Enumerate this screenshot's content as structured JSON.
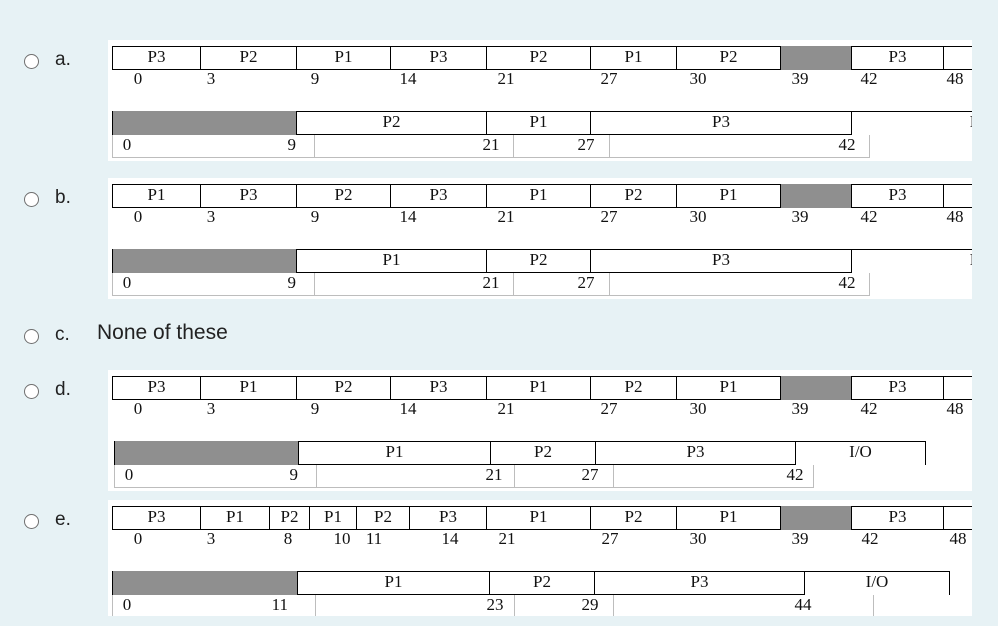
{
  "options": [
    {
      "letter": "a.",
      "cpu": [
        {
          "label": "P3",
          "start": 0,
          "end": 3
        },
        {
          "label": "P2",
          "start": 3,
          "end": 9
        },
        {
          "label": "P1",
          "start": 9,
          "end": 14
        },
        {
          "label": "P3",
          "start": 14,
          "end": 21
        },
        {
          "label": "P2",
          "start": 21,
          "end": 27
        },
        {
          "label": "P1",
          "start": 27,
          "end": 30
        },
        {
          "label": "P2",
          "start": 30,
          "end": 39
        },
        {
          "label": "",
          "start": 39,
          "end": 42,
          "idle": true
        },
        {
          "label": "P3",
          "start": 42,
          "end": 48
        }
      ],
      "cpu_ticks": [
        "0",
        "3",
        "9",
        "14",
        "21",
        "27",
        "30",
        "39",
        "42",
        "48"
      ],
      "io": [
        {
          "label": "",
          "start": 0,
          "end": 9,
          "idle": true
        },
        {
          "label": "P2",
          "start": 9,
          "end": 21
        },
        {
          "label": "P1",
          "start": 21,
          "end": 27
        },
        {
          "label": "P3",
          "start": 27,
          "end": 42
        },
        {
          "label": "I/",
          "start": 42,
          "end": 48,
          "cut": true
        }
      ],
      "io_ticks": [
        "0",
        "9",
        "21",
        "27",
        "42"
      ]
    },
    {
      "letter": "b.",
      "cpu": [
        {
          "label": "P1",
          "start": 0,
          "end": 3
        },
        {
          "label": "P3",
          "start": 3,
          "end": 9
        },
        {
          "label": "P2",
          "start": 9,
          "end": 14
        },
        {
          "label": "P3",
          "start": 14,
          "end": 21
        },
        {
          "label": "P1",
          "start": 21,
          "end": 27
        },
        {
          "label": "P2",
          "start": 27,
          "end": 30
        },
        {
          "label": "P1",
          "start": 30,
          "end": 39
        },
        {
          "label": "",
          "start": 39,
          "end": 42,
          "idle": true
        },
        {
          "label": "P3",
          "start": 42,
          "end": 48
        }
      ],
      "cpu_ticks": [
        "0",
        "3",
        "9",
        "14",
        "21",
        "27",
        "30",
        "39",
        "42",
        "48"
      ],
      "io": [
        {
          "label": "",
          "start": 0,
          "end": 9,
          "idle": true
        },
        {
          "label": "P1",
          "start": 9,
          "end": 21
        },
        {
          "label": "P2",
          "start": 21,
          "end": 27
        },
        {
          "label": "P3",
          "start": 27,
          "end": 42
        },
        {
          "label": "I/",
          "start": 42,
          "end": 48,
          "cut": true
        }
      ],
      "io_ticks": [
        "0",
        "9",
        "21",
        "27",
        "42"
      ]
    },
    {
      "letter": "c.",
      "text": "None of these"
    },
    {
      "letter": "d.",
      "cpu": [
        {
          "label": "P3",
          "start": 0,
          "end": 3
        },
        {
          "label": "P1",
          "start": 3,
          "end": 9
        },
        {
          "label": "P2",
          "start": 9,
          "end": 14
        },
        {
          "label": "P3",
          "start": 14,
          "end": 21
        },
        {
          "label": "P1",
          "start": 21,
          "end": 27
        },
        {
          "label": "P2",
          "start": 27,
          "end": 30
        },
        {
          "label": "P1",
          "start": 30,
          "end": 39
        },
        {
          "label": "",
          "start": 39,
          "end": 42,
          "idle": true
        },
        {
          "label": "P3",
          "start": 42,
          "end": 48
        }
      ],
      "cpu_ticks": [
        "0",
        "3",
        "9",
        "14",
        "21",
        "27",
        "30",
        "39",
        "42",
        "48"
      ],
      "io": [
        {
          "label": "",
          "start": 0,
          "end": 9,
          "idle": true
        },
        {
          "label": "P1",
          "start": 9,
          "end": 21
        },
        {
          "label": "P2",
          "start": 21,
          "end": 27
        },
        {
          "label": "P3",
          "start": 27,
          "end": 42
        },
        {
          "label": "I/O",
          "start": 42,
          "end": 48
        }
      ],
      "io_ticks": [
        "0",
        "9",
        "21",
        "27",
        "42"
      ]
    },
    {
      "letter": "e.",
      "cpu": [
        {
          "label": "P3",
          "start": 0,
          "end": 3
        },
        {
          "label": "P1",
          "start": 3,
          "end": 8
        },
        {
          "label": "P2",
          "start": 8,
          "end": 10
        },
        {
          "label": "P1",
          "start": 10,
          "end": 11
        },
        {
          "label": "P2",
          "start": 11,
          "end": 14
        },
        {
          "label": "P3",
          "start": 14,
          "end": 21
        },
        {
          "label": "P1",
          "start": 21,
          "end": 27
        },
        {
          "label": "P2",
          "start": 27,
          "end": 30
        },
        {
          "label": "P1",
          "start": 30,
          "end": 39
        },
        {
          "label": "",
          "start": 39,
          "end": 42,
          "idle": true
        },
        {
          "label": "P3",
          "start": 42,
          "end": 48
        }
      ],
      "cpu_ticks": [
        "0",
        "3",
        "8",
        "10",
        "11",
        "14",
        "21",
        "27",
        "30",
        "39",
        "42",
        "48"
      ],
      "io": [
        {
          "label": "",
          "start": 0,
          "end": 11,
          "idle": true
        },
        {
          "label": "P1",
          "start": 11,
          "end": 23
        },
        {
          "label": "P2",
          "start": 23,
          "end": 29
        },
        {
          "label": "P3",
          "start": 29,
          "end": 44
        },
        {
          "label": "I/O",
          "start": 44,
          "end": 48
        }
      ],
      "io_ticks": [
        "0",
        "11",
        "23",
        "29",
        "44"
      ]
    }
  ]
}
